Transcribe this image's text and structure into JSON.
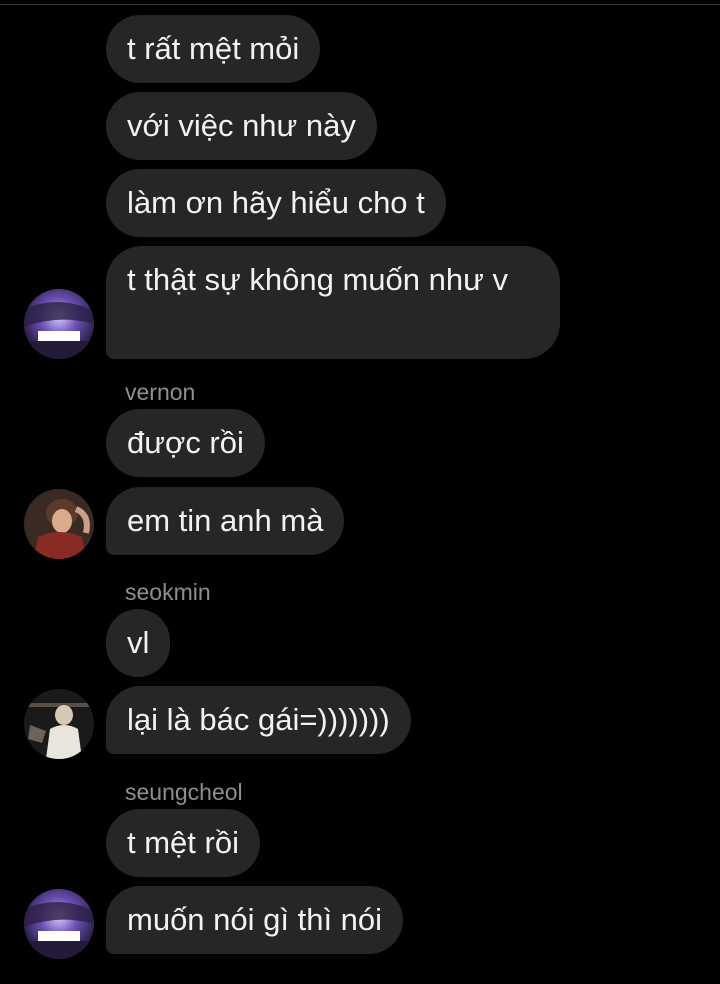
{
  "colors": {
    "background": "#000000",
    "bubble": "#262629",
    "text": "#f2f2f2",
    "sender": "#8e8e93"
  },
  "messages": [
    {
      "text": "t rất mệt mỏi"
    },
    {
      "text": "với việc như này"
    },
    {
      "text": "làm ơn hãy hiểu cho t"
    },
    {
      "text": "t thật sự không muốn như v"
    },
    {
      "sender": "vernon",
      "text": "được rồi"
    },
    {
      "text": "em tin anh mà"
    },
    {
      "sender": "seokmin",
      "text": "vl"
    },
    {
      "text": "lại là bác gái=)))))))"
    },
    {
      "sender": "seungcheol",
      "text": "t mệt rồi"
    },
    {
      "text": "muốn nói gì thì nói"
    }
  ],
  "avatars": [
    "avatar-purple-icon",
    "avatar-photo-icon",
    "avatar-photo-icon",
    "avatar-purple-icon"
  ]
}
